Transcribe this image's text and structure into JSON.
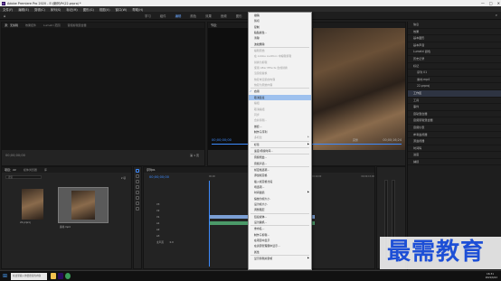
{
  "title_bar": {
    "logo_text": "Pr",
    "title": "Adobe Premiere Pro 2020 - E:\\案例\\Pr\\22.prproj *",
    "min": "—",
    "max": "□",
    "close": "✕"
  },
  "menu_bar": [
    "文件(F)",
    "编辑(E)",
    "剪辑(C)",
    "序列(S)",
    "标记(M)",
    "图形(G)",
    "视图(V)",
    "窗口(W)",
    "帮助(H)"
  ],
  "workspace_tabs": [
    "学习",
    "组件",
    "编辑",
    "颜色",
    "效果",
    "音频",
    "图形",
    "库"
  ],
  "source_panel": {
    "tabs": [
      "源：无剪辑",
      "效果控件",
      "Lumetri 范围",
      "音频剪辑混合器"
    ],
    "timecode": "00;00;00;00",
    "page_label": "第 1 页"
  },
  "program_panel": {
    "tab": "节目：",
    "timecode": "00;00;00;00",
    "fit": "完整",
    "duration": "00;00;16;24"
  },
  "project_panel": {
    "tabs": [
      "项目：22",
      "媒体浏览器",
      "库"
    ],
    "search_placeholder": "搜索",
    "item_count": "2 项",
    "clips": [
      {
        "name": "22.prproj",
        "duration": ""
      },
      {
        "name": "素材.mp4",
        "duration": ""
      }
    ]
  },
  "timeline": {
    "tab": "序列01",
    "timecode": "00;00;00;00",
    "ruler": [
      "00;00",
      "00;00;05;00",
      "00;00;10;00",
      "00;00;15;00"
    ],
    "tracks_video": [
      "V3",
      "V2",
      "V1"
    ],
    "tracks_audio": [
      "A1",
      "A2",
      "A3"
    ],
    "master": "主声道",
    "master_value": "0.0"
  },
  "context_menu": {
    "items": [
      {
        "label": "撤销",
        "disabled": false
      },
      {
        "label": "剪切",
        "disabled": false
      },
      {
        "label": "复制",
        "disabled": false
      },
      {
        "label": "粘贴属性...",
        "disabled": false
      },
      {
        "label": "清除",
        "disabled": false
      },
      {
        "label": "波纹删除",
        "disabled": false
      },
      {
        "sep": true
      },
      {
        "label": "编辑原始",
        "disabled": true
      },
      {
        "label": "在 Adobe Audition 中编辑剪辑",
        "disabled": true
      },
      {
        "label": "替换为剪辑",
        "disabled": true
      },
      {
        "label": "使用 After Effects 合成替换",
        "disabled": true
      },
      {
        "label": "渲染和替换",
        "disabled": true
      },
      {
        "label": "恢复未渲染的内容",
        "disabled": true
      },
      {
        "label": "恢复为原始内容",
        "disabled": true
      },
      {
        "sep": true
      },
      {
        "label": "启用",
        "checked": true
      },
      {
        "label": "取消链接",
        "highlight": true
      },
      {
        "label": "编组",
        "disabled": true
      },
      {
        "label": "取消编组",
        "disabled": true
      },
      {
        "label": "同步",
        "disabled": true
      },
      {
        "label": "合并剪辑...",
        "disabled": true
      },
      {
        "label": "嵌套...",
        "disabled": false
      },
      {
        "label": "制作子序列",
        "disabled": false
      },
      {
        "label": "多机位",
        "disabled": true,
        "arrow": true
      },
      {
        "sep": true
      },
      {
        "label": "标签",
        "arrow": true
      },
      {
        "sep": true
      },
      {
        "label": "速度/持续时间...",
        "disabled": false
      },
      {
        "sep": true
      },
      {
        "label": "音频增益...",
        "disabled": false
      },
      {
        "label": "音频声道...",
        "disabled": false
      },
      {
        "sep": true
      },
      {
        "label": "帧定格选项...",
        "disabled": false
      },
      {
        "label": "添加帧定格",
        "disabled": false
      },
      {
        "label": "插入帧定格分段",
        "disabled": false
      },
      {
        "label": "场选项...",
        "disabled": false
      },
      {
        "label": "时间插值",
        "arrow": true
      },
      {
        "label": "缩放为帧大小",
        "disabled": false
      },
      {
        "label": "设为帧大小",
        "disabled": false
      },
      {
        "label": "调整图层",
        "disabled": false
      },
      {
        "sep": true
      },
      {
        "label": "链接媒体...",
        "disabled": false
      },
      {
        "label": "设为脱机...",
        "disabled": false
      },
      {
        "sep": true
      },
      {
        "label": "重命名...",
        "disabled": false
      },
      {
        "label": "制作子剪辑...",
        "disabled": false
      },
      {
        "label": "在项目中显示",
        "disabled": false
      },
      {
        "label": "在资源管理器中显示...",
        "disabled": false
      },
      {
        "label": "属性",
        "disabled": false
      },
      {
        "sep": true
      },
      {
        "label": "显示剪辑关键帧",
        "arrow": true
      }
    ]
  },
  "right_list": [
    "信息",
    "效果",
    "基本图形",
    "基本声音",
    "Lumetri 颜色",
    "历史记录",
    "标记",
    "序列 01",
    "素材.mp4",
    "22.prproj",
    "工作区",
    "工具",
    "事件",
    "音轨混合器",
    "音频剪辑混合器",
    "音频仪表",
    "参考监视器",
    "源监视器",
    "时间码",
    "进度",
    "捕捉"
  ],
  "right_list_selected": 10,
  "taskbar": {
    "search": "在这里输入你要搜索的内容",
    "time": "16:31",
    "date": "2021/6/22"
  },
  "watermark": "最需教育",
  "colors": {
    "accent": "#3d8bff",
    "highlight": "#9ec1ee",
    "clip_video": "#7b9fd4",
    "clip_audio": "#4b9a69",
    "watermark": "#1d4fd6"
  }
}
